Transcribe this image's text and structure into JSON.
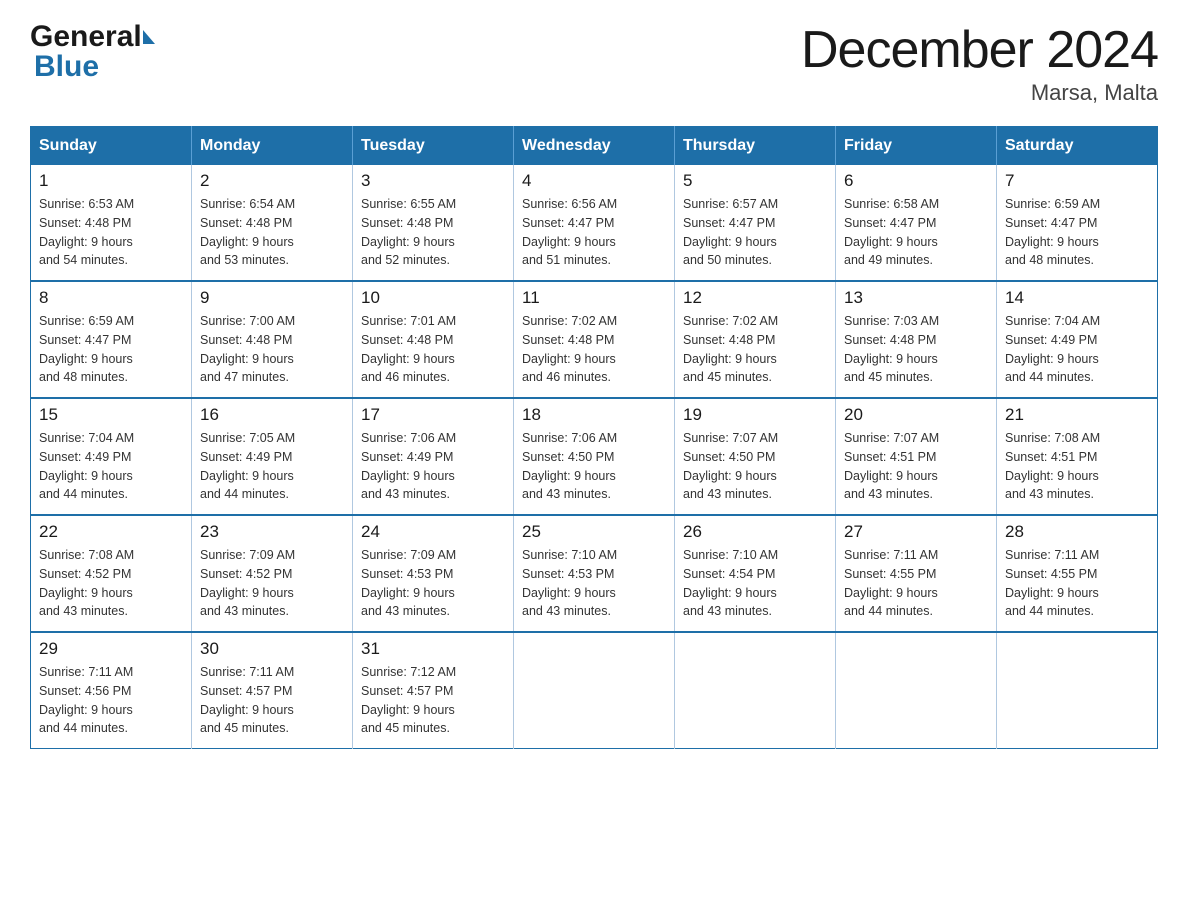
{
  "header": {
    "logo_general": "General",
    "logo_blue": "Blue",
    "month_title": "December 2024",
    "location": "Marsa, Malta"
  },
  "calendar": {
    "days_of_week": [
      "Sunday",
      "Monday",
      "Tuesday",
      "Wednesday",
      "Thursday",
      "Friday",
      "Saturday"
    ],
    "weeks": [
      [
        {
          "day": "1",
          "sunrise": "6:53 AM",
          "sunset": "4:48 PM",
          "daylight": "9 hours and 54 minutes."
        },
        {
          "day": "2",
          "sunrise": "6:54 AM",
          "sunset": "4:48 PM",
          "daylight": "9 hours and 53 minutes."
        },
        {
          "day": "3",
          "sunrise": "6:55 AM",
          "sunset": "4:48 PM",
          "daylight": "9 hours and 52 minutes."
        },
        {
          "day": "4",
          "sunrise": "6:56 AM",
          "sunset": "4:47 PM",
          "daylight": "9 hours and 51 minutes."
        },
        {
          "day": "5",
          "sunrise": "6:57 AM",
          "sunset": "4:47 PM",
          "daylight": "9 hours and 50 minutes."
        },
        {
          "day": "6",
          "sunrise": "6:58 AM",
          "sunset": "4:47 PM",
          "daylight": "9 hours and 49 minutes."
        },
        {
          "day": "7",
          "sunrise": "6:59 AM",
          "sunset": "4:47 PM",
          "daylight": "9 hours and 48 minutes."
        }
      ],
      [
        {
          "day": "8",
          "sunrise": "6:59 AM",
          "sunset": "4:47 PM",
          "daylight": "9 hours and 48 minutes."
        },
        {
          "day": "9",
          "sunrise": "7:00 AM",
          "sunset": "4:48 PM",
          "daylight": "9 hours and 47 minutes."
        },
        {
          "day": "10",
          "sunrise": "7:01 AM",
          "sunset": "4:48 PM",
          "daylight": "9 hours and 46 minutes."
        },
        {
          "day": "11",
          "sunrise": "7:02 AM",
          "sunset": "4:48 PM",
          "daylight": "9 hours and 46 minutes."
        },
        {
          "day": "12",
          "sunrise": "7:02 AM",
          "sunset": "4:48 PM",
          "daylight": "9 hours and 45 minutes."
        },
        {
          "day": "13",
          "sunrise": "7:03 AM",
          "sunset": "4:48 PM",
          "daylight": "9 hours and 45 minutes."
        },
        {
          "day": "14",
          "sunrise": "7:04 AM",
          "sunset": "4:49 PM",
          "daylight": "9 hours and 44 minutes."
        }
      ],
      [
        {
          "day": "15",
          "sunrise": "7:04 AM",
          "sunset": "4:49 PM",
          "daylight": "9 hours and 44 minutes."
        },
        {
          "day": "16",
          "sunrise": "7:05 AM",
          "sunset": "4:49 PM",
          "daylight": "9 hours and 44 minutes."
        },
        {
          "day": "17",
          "sunrise": "7:06 AM",
          "sunset": "4:49 PM",
          "daylight": "9 hours and 43 minutes."
        },
        {
          "day": "18",
          "sunrise": "7:06 AM",
          "sunset": "4:50 PM",
          "daylight": "9 hours and 43 minutes."
        },
        {
          "day": "19",
          "sunrise": "7:07 AM",
          "sunset": "4:50 PM",
          "daylight": "9 hours and 43 minutes."
        },
        {
          "day": "20",
          "sunrise": "7:07 AM",
          "sunset": "4:51 PM",
          "daylight": "9 hours and 43 minutes."
        },
        {
          "day": "21",
          "sunrise": "7:08 AM",
          "sunset": "4:51 PM",
          "daylight": "9 hours and 43 minutes."
        }
      ],
      [
        {
          "day": "22",
          "sunrise": "7:08 AM",
          "sunset": "4:52 PM",
          "daylight": "9 hours and 43 minutes."
        },
        {
          "day": "23",
          "sunrise": "7:09 AM",
          "sunset": "4:52 PM",
          "daylight": "9 hours and 43 minutes."
        },
        {
          "day": "24",
          "sunrise": "7:09 AM",
          "sunset": "4:53 PM",
          "daylight": "9 hours and 43 minutes."
        },
        {
          "day": "25",
          "sunrise": "7:10 AM",
          "sunset": "4:53 PM",
          "daylight": "9 hours and 43 minutes."
        },
        {
          "day": "26",
          "sunrise": "7:10 AM",
          "sunset": "4:54 PM",
          "daylight": "9 hours and 43 minutes."
        },
        {
          "day": "27",
          "sunrise": "7:11 AM",
          "sunset": "4:55 PM",
          "daylight": "9 hours and 44 minutes."
        },
        {
          "day": "28",
          "sunrise": "7:11 AM",
          "sunset": "4:55 PM",
          "daylight": "9 hours and 44 minutes."
        }
      ],
      [
        {
          "day": "29",
          "sunrise": "7:11 AM",
          "sunset": "4:56 PM",
          "daylight": "9 hours and 44 minutes."
        },
        {
          "day": "30",
          "sunrise": "7:11 AM",
          "sunset": "4:57 PM",
          "daylight": "9 hours and 45 minutes."
        },
        {
          "day": "31",
          "sunrise": "7:12 AM",
          "sunset": "4:57 PM",
          "daylight": "9 hours and 45 minutes."
        },
        null,
        null,
        null,
        null
      ]
    ]
  }
}
